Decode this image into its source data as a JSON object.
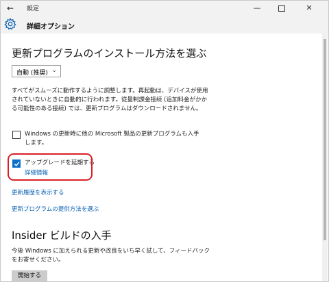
{
  "titlebar": {
    "back_icon": "back-arrow-icon",
    "app_title": "設定",
    "minimize": "—",
    "close": "✕"
  },
  "header": {
    "icon": "gear-icon",
    "title": "詳細オプション"
  },
  "updates": {
    "title": "更新プログラムのインストール方法を選ぶ",
    "dropdown_value": "自動 (推奨)",
    "description": "すべてがスムーズに動作するように調整します。再起動は、デバイスが使用されていないときに自動的に行われます。従量制課金接続 (追加料金がかかる可能性のある接続) では、更新プログラムはダウンロードされません。",
    "checkbox_ms_label": "Windows の更新時に他の Microsoft 製品の更新プログラムも入手します。",
    "checkbox_ms_checked": false,
    "checkbox_defer_label": "アップグレードを延期する",
    "checkbox_defer_checked": true,
    "details_link": "詳細情報",
    "history_link": "更新履歴を表示する",
    "delivery_link": "更新プログラムの提供方法を選ぶ"
  },
  "insider": {
    "title": "Insider ビルドの入手",
    "description": "今後 Windows に加えられる更新や改良をいち早く試して、フィードバックをお寄せください。",
    "start_button": "開始する"
  },
  "colors": {
    "accent": "#0a70c9",
    "link": "#0a62b4",
    "highlight": "#d91f26"
  }
}
